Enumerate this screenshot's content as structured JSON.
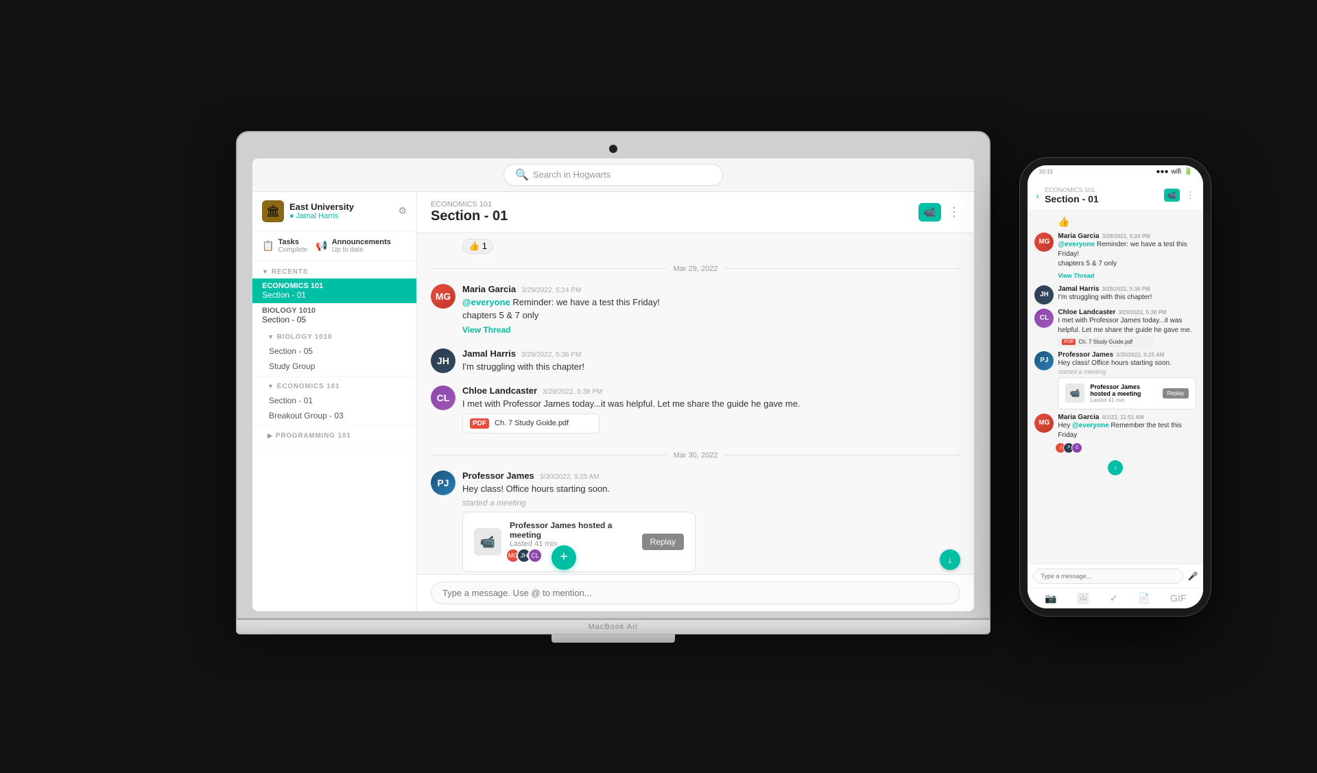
{
  "scene": {
    "background": "#1a1a1a"
  },
  "macbook": {
    "label": "MacBook Air",
    "search": {
      "placeholder": "Search in Hogwarts"
    }
  },
  "sidebar": {
    "org": {
      "name": "East University",
      "user": "Jamal Harris",
      "icon": "🏛"
    },
    "widgets": [
      {
        "icon": "📋",
        "label": "Tasks",
        "sub": "Complete"
      },
      {
        "icon": "📢",
        "label": "Announcements",
        "sub": "Up to date"
      }
    ],
    "recents_label": "RECENTS",
    "items": [
      {
        "course": "ECONOMICS 101",
        "section": "Section - 01",
        "active": true
      },
      {
        "course": "BIOLOGY 1010",
        "section": "Section - 05",
        "active": false
      }
    ],
    "groups": [
      {
        "label": "BIOLOGY 1010",
        "items": [
          "Section - 05",
          "Study Group"
        ]
      },
      {
        "label": "ECONOMICS 101",
        "items": [
          "Section - 01",
          "Breakout Group - 03"
        ]
      },
      {
        "label": "PROGRAMMING 101",
        "items": []
      }
    ]
  },
  "channel": {
    "course": "ECONOMICS 101",
    "name": "Section - 01"
  },
  "messages": [
    {
      "date_divider": "Mar 29, 2022"
    },
    {
      "author": "Maria Garcia",
      "time": "3/29/2022, 5:24 PM",
      "avatar_class": "avatar-maria",
      "avatar_initials": "MG",
      "text_parts": [
        {
          "type": "mention",
          "text": "@everyone"
        },
        {
          "type": "text",
          "text": " Reminder: we have a test this Friday!"
        }
      ],
      "extra_text": "chapters 5 & 7 only",
      "reaction": "👍 1",
      "thread_link": "View Thread"
    },
    {
      "author": "Jamal Harris",
      "time": "3/29/2022, 5:36 PM",
      "avatar_class": "avatar-jamal",
      "avatar_initials": "JH",
      "text": "I'm struggling with this chapter!"
    },
    {
      "author": "Chloe Landcaster",
      "time": "3/29/2022, 5:38 PM",
      "avatar_class": "avatar-chloe",
      "avatar_initials": "CL",
      "text": "I met with Professor James today...it was helpful. Let me share the guide he gave me.",
      "attachment": "Ch. 7 Study Guide.pdf"
    },
    {
      "date_divider": "Mar 30, 2022"
    },
    {
      "author": "Professor James",
      "time": "3/30/2022, 9:25 AM",
      "avatar_class": "avatar-prof",
      "avatar_initials": "PJ",
      "text": "Hey class! Office hours starting soon.",
      "started_meeting": "started a meeting",
      "meeting": {
        "title": "Professor James hosted a meeting",
        "duration": "Lasted 41 min",
        "replay": "Replay"
      }
    }
  ],
  "input_placeholder": "Type a message. Use @ to mention...",
  "phone": {
    "time": "10:15",
    "channel_course": "ECONOMICS 101",
    "channel_name": "Section - 01",
    "messages": [
      {
        "author": "Maria Garcia",
        "time": "3/29/2022, 5:24 PM",
        "avatar_class": "avatar-maria",
        "text_mention": "@everyone",
        "text_body": " Reminder: we have a test this Friday!",
        "extra": "chapters 5 & 7 only",
        "thread_link": "View Thread"
      },
      {
        "author": "Jamal Harris",
        "time": "3/29/2022, 5:36 PM",
        "avatar_class": "avatar-jamal",
        "text": "I'm struggling with this chapter!"
      },
      {
        "author": "Chloe Landcaster",
        "time": "3/29/2022, 5:38 PM",
        "avatar_class": "avatar-chloe",
        "text": "I met with Professor James today...it was helpful. Let me share the guide he gave me.",
        "file": "Ch. 7 Study Guide.pdf"
      },
      {
        "author": "Professor James",
        "time": "3/30/2022, 9:25 AM",
        "avatar_class": "avatar-prof",
        "text": "Hey class! Office hours starting soon.",
        "started_meeting": "started a meeting",
        "meeting_title": "Professor James hosted a meeting",
        "meeting_duration": "Lasted 41 min"
      },
      {
        "author": "Maria Garcia",
        "time": "4/1/22, 11:51 AM",
        "avatar_class": "avatar-maria",
        "text_mention": "@everyone",
        "text_body": " Remember the test this Friday"
      }
    ],
    "input_placeholder": "Type a message..."
  }
}
